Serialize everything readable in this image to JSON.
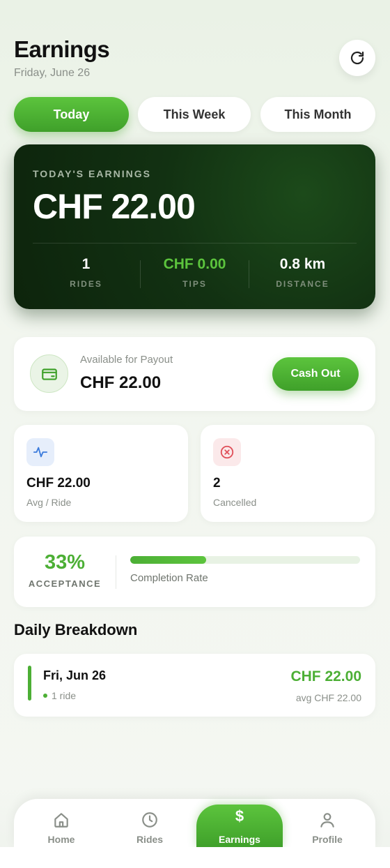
{
  "header": {
    "title": "Earnings",
    "date": "Friday, June 26"
  },
  "tabs": [
    {
      "label": "Today",
      "active": true
    },
    {
      "label": "This Week",
      "active": false
    },
    {
      "label": "This Month",
      "active": false
    }
  ],
  "summary": {
    "label": "TODAY'S EARNINGS",
    "amount": "CHF 22.00",
    "stats": [
      {
        "value": "1",
        "label": "RIDES"
      },
      {
        "value": "CHF 0.00",
        "label": "TIPS"
      },
      {
        "value": "0.8 km",
        "label": "DISTANCE"
      }
    ]
  },
  "payout": {
    "label": "Available for Payout",
    "amount": "CHF 22.00",
    "button": "Cash Out"
  },
  "stat_cards": [
    {
      "value": "CHF 22.00",
      "label": "Avg / Ride",
      "icon": "activity-icon"
    },
    {
      "value": "2",
      "label": "Cancelled",
      "icon": "cancel-circle-icon"
    }
  ],
  "acceptance": {
    "percent_text": "33%",
    "label": "ACCEPTANCE",
    "caption": "Completion Rate",
    "completion_fraction": 0.33
  },
  "daily": {
    "title": "Daily Breakdown",
    "items": [
      {
        "date": "Fri, Jun 26",
        "rides": "1 ride",
        "amount": "CHF 22.00",
        "avg": "avg CHF 22.00"
      }
    ]
  },
  "nav": [
    {
      "label": "Home",
      "icon": "home-icon"
    },
    {
      "label": "Rides",
      "icon": "clock-icon"
    },
    {
      "label": "Earnings",
      "icon": "dollar-icon",
      "glyph": "$"
    },
    {
      "label": "Profile",
      "icon": "user-icon"
    }
  ],
  "colors": {
    "accent": "#4caf35",
    "accent_light": "#5cc43d",
    "card_dark": "#123112",
    "danger": "#e0505a",
    "info": "#3b7bdc"
  }
}
